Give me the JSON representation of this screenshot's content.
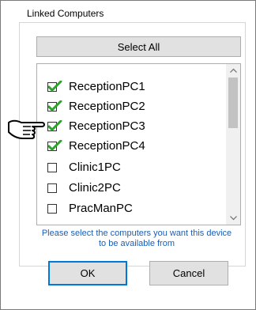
{
  "window": {
    "title": "Linked Computers"
  },
  "buttons": {
    "select_all": "Select All",
    "ok": "OK",
    "cancel": "Cancel"
  },
  "computers": [
    {
      "name": "ReceptionPC1",
      "checked": true
    },
    {
      "name": "ReceptionPC2",
      "checked": true
    },
    {
      "name": "ReceptionPC3",
      "checked": true
    },
    {
      "name": "ReceptionPC4",
      "checked": true
    },
    {
      "name": "Clinic1PC",
      "checked": false
    },
    {
      "name": "Clinic2PC",
      "checked": false
    },
    {
      "name": "PracManPC",
      "checked": false
    }
  ],
  "hint": "Please select the computers you want this device to be available from",
  "colors": {
    "check": "#2aa52a",
    "hint": "#1a5fb4",
    "focus": "#0078d7"
  },
  "icons": {
    "pointer": "hand-pointer-icon",
    "check": "check-mark-icon"
  }
}
